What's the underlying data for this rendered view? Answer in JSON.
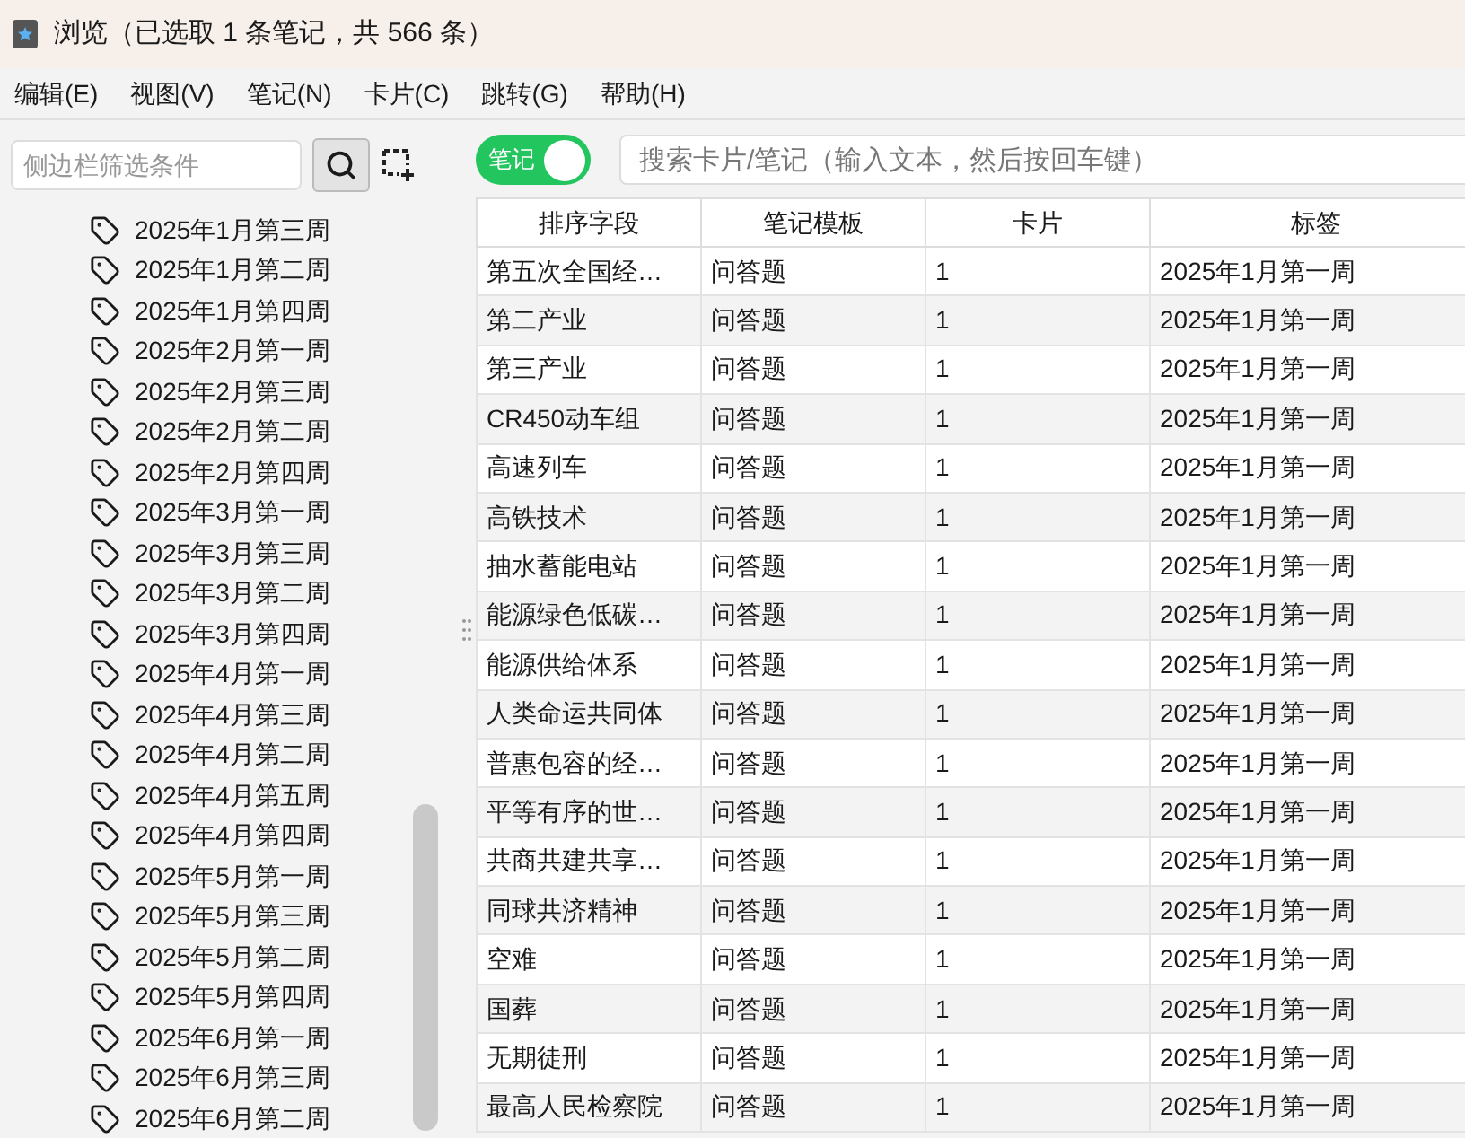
{
  "window": {
    "title": "浏览（已选取 1 条笔记，共 566 条）"
  },
  "menu": [
    "编辑(E)",
    "视图(V)",
    "笔记(N)",
    "卡片(C)",
    "跳转(G)",
    "帮助(H)"
  ],
  "sidebar": {
    "filter_placeholder": "侧边栏筛选条件",
    "items": [
      "2025年1月第三周",
      "2025年1月第二周",
      "2025年1月第四周",
      "2025年2月第一周",
      "2025年2月第三周",
      "2025年2月第二周",
      "2025年2月第四周",
      "2025年3月第一周",
      "2025年3月第三周",
      "2025年3月第二周",
      "2025年3月第四周",
      "2025年4月第一周",
      "2025年4月第三周",
      "2025年4月第二周",
      "2025年4月第五周",
      "2025年4月第四周",
      "2025年5月第一周",
      "2025年5月第三周",
      "2025年5月第二周",
      "2025年5月第四周",
      "2025年6月第一周",
      "2025年6月第三周",
      "2025年6月第二周"
    ]
  },
  "mode_toggle": {
    "label": "笔记",
    "on": true
  },
  "search": {
    "placeholder": "搜索卡片/笔记（输入文本，然后按回车键）"
  },
  "table": {
    "columns": [
      "排序字段",
      "笔记模板",
      "卡片",
      "标签"
    ],
    "rows": [
      [
        "第五次全国经…",
        "问答题",
        "1",
        "2025年1月第一周"
      ],
      [
        "第二产业",
        "问答题",
        "1",
        "2025年1月第一周"
      ],
      [
        "第三产业",
        "问答题",
        "1",
        "2025年1月第一周"
      ],
      [
        "CR450动车组",
        "问答题",
        "1",
        "2025年1月第一周"
      ],
      [
        "高速列车",
        "问答题",
        "1",
        "2025年1月第一周"
      ],
      [
        "高铁技术",
        "问答题",
        "1",
        "2025年1月第一周"
      ],
      [
        "抽水蓄能电站",
        "问答题",
        "1",
        "2025年1月第一周"
      ],
      [
        "能源绿色低碳…",
        "问答题",
        "1",
        "2025年1月第一周"
      ],
      [
        "能源供给体系",
        "问答题",
        "1",
        "2025年1月第一周"
      ],
      [
        "人类命运共同体",
        "问答题",
        "1",
        "2025年1月第一周"
      ],
      [
        "普惠包容的经…",
        "问答题",
        "1",
        "2025年1月第一周"
      ],
      [
        "平等有序的世…",
        "问答题",
        "1",
        "2025年1月第一周"
      ],
      [
        "共商共建共享…",
        "问答题",
        "1",
        "2025年1月第一周"
      ],
      [
        "同球共济精神",
        "问答题",
        "1",
        "2025年1月第一周"
      ],
      [
        "空难",
        "问答题",
        "1",
        "2025年1月第一周"
      ],
      [
        "国葬",
        "问答题",
        "1",
        "2025年1月第一周"
      ],
      [
        "无期徒刑",
        "问答题",
        "1",
        "2025年1月第一周"
      ],
      [
        "最高人民检察院",
        "问答题",
        "1",
        "2025年1月第一周"
      ]
    ]
  }
}
